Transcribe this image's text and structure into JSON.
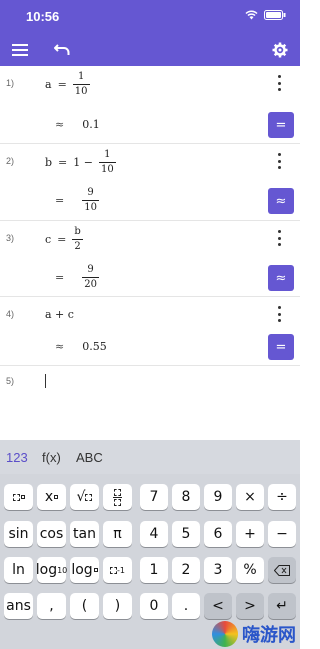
{
  "status": {
    "time": "10:56"
  },
  "toolbar": {
    "menu_icon": "menu-icon",
    "undo_icon": "undo-icon",
    "settings_icon": "gear-icon"
  },
  "rows": [
    {
      "num": "1)",
      "lhs": "a",
      "eq": "=",
      "num_top": "1",
      "num_bottom": "10",
      "out_sym": "≈",
      "out_val": "0.1",
      "toggle": "="
    },
    {
      "num": "2)",
      "lhs": "b",
      "eq": "=",
      "prefix": "1 −",
      "num_top": "1",
      "num_bottom": "10",
      "out_sym": "=",
      "out_top": "9",
      "out_bottom": "10",
      "toggle": "≈"
    },
    {
      "num": "3)",
      "lhs": "c",
      "eq": "=",
      "num_top": "b",
      "num_bottom": "2",
      "out_sym": "=",
      "out_top": "9",
      "out_bottom": "20",
      "toggle": "≈"
    },
    {
      "num": "4)",
      "expr": "a + c",
      "out_sym": "≈",
      "out_val": "0.55",
      "toggle": "="
    },
    {
      "num": "5)"
    }
  ],
  "keyboard": {
    "tabs": [
      "123",
      "f(x)",
      "ABC"
    ],
    "active_tab": "123",
    "row1": [
      "x²",
      "x□",
      "√□",
      "□/□",
      "7",
      "8",
      "9",
      "×",
      "÷"
    ],
    "row2": [
      "sin",
      "cos",
      "tan",
      "π",
      "4",
      "5",
      "6",
      "+",
      "−"
    ],
    "row3": [
      "ln",
      "log10",
      "log□",
      "□⁻¹",
      "1",
      "2",
      "3",
      "%",
      "⌫"
    ],
    "row4": [
      "ans",
      ",",
      "(",
      ")",
      "0",
      ".",
      "<",
      ">",
      "↵"
    ],
    "sub_10": "10"
  },
  "watermark": {
    "text": "嗨游网"
  }
}
